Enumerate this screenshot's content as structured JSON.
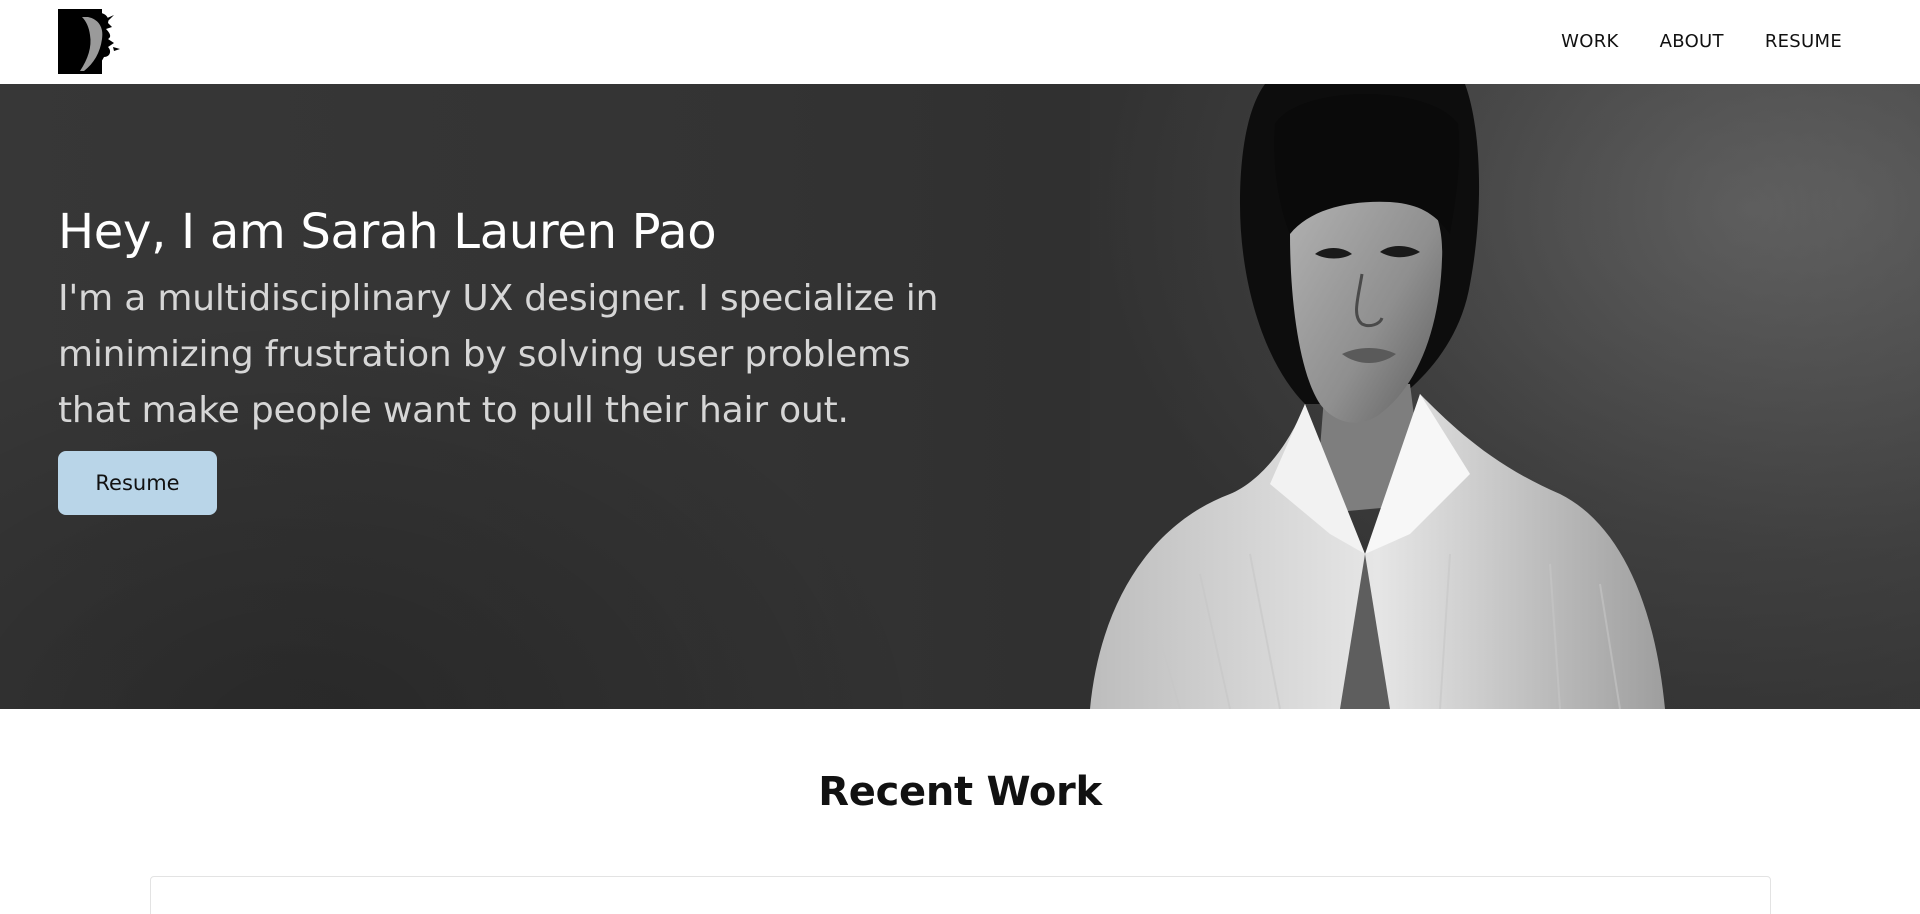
{
  "header": {
    "logo_icon": "face-silhouette-logo-icon",
    "nav": [
      {
        "label": "WORK"
      },
      {
        "label": "ABOUT"
      },
      {
        "label": "RESUME"
      }
    ]
  },
  "hero": {
    "title": "Hey, I am Sarah Lauren Pao",
    "subtitle": "I'm a multidisciplinary UX designer. I specialize in minimizing frustration by solving user problems that make people want to pull their hair out.",
    "button_label": "Resume",
    "button_color": "#b9d5e8",
    "background_color": "#333333"
  },
  "recent_work": {
    "title": "Recent Work"
  }
}
